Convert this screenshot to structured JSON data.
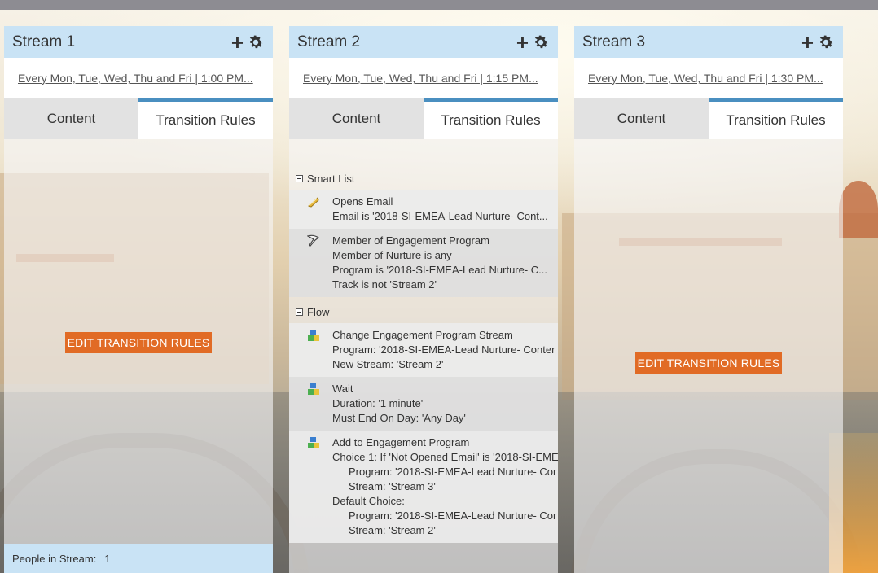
{
  "streams": [
    {
      "title": "Stream 1",
      "schedule": "Every Mon, Tue, Wed, Thu and Fri | 1:00 PM...",
      "tabs": {
        "content": "Content",
        "transition_rules": "Transition Rules"
      },
      "edit_button": "EDIT TRANSITION RULES",
      "people_label": "People in Stream:",
      "people_count": "1"
    },
    {
      "title": "Stream 2",
      "schedule": "Every Mon, Tue, Wed, Thu and Fri | 1:15 PM...",
      "tabs": {
        "content": "Content",
        "transition_rules": "Transition Rules"
      },
      "smart_list": {
        "title": "Smart List",
        "rules": [
          {
            "icon": "email-icon",
            "lines": [
              "Opens Email",
              "Email is '2018-SI-EMEA-Lead Nurture- Cont..."
            ]
          },
          {
            "icon": "engagement-filter-icon",
            "lines": [
              "Member of Engagement Program",
              "Member of Nurture is any",
              "Program is '2018-SI-EMEA-Lead Nurture- C...",
              "Track is not 'Stream 2'"
            ]
          }
        ]
      },
      "flow": {
        "title": "Flow",
        "steps": [
          {
            "icon": "flow-step-icon",
            "lines": [
              "Change Engagement Program Stream",
              "Program: '2018-SI-EMEA-Lead Nurture- Conter",
              "New Stream: 'Stream 2'"
            ]
          },
          {
            "icon": "flow-step-icon",
            "lines": [
              "Wait",
              "Duration: '1 minute'",
              "Must End On Day: 'Any Day'"
            ]
          },
          {
            "icon": "flow-step-icon",
            "lines": [
              "Add to Engagement Program",
              "Choice 1: If 'Not Opened Email' is '2018-SI-EME",
              "Program: '2018-SI-EMEA-Lead Nurture- Cor",
              "Stream: 'Stream 3'",
              "Default Choice:",
              "Program: '2018-SI-EMEA-Lead Nurture- Cor",
              "Stream: 'Stream 2'"
            ]
          }
        ]
      }
    },
    {
      "title": "Stream 3",
      "schedule": "Every Mon, Tue, Wed, Thu and Fri | 1:30 PM...",
      "tabs": {
        "content": "Content",
        "transition_rules": "Transition Rules"
      },
      "edit_button": "EDIT TRANSITION RULES"
    }
  ],
  "colors": {
    "header_bg": "#c9e3f5",
    "active_tab_border": "#4a8fc0",
    "edit_button_bg": "#e16b25",
    "top_bar": "#8d8c92"
  }
}
